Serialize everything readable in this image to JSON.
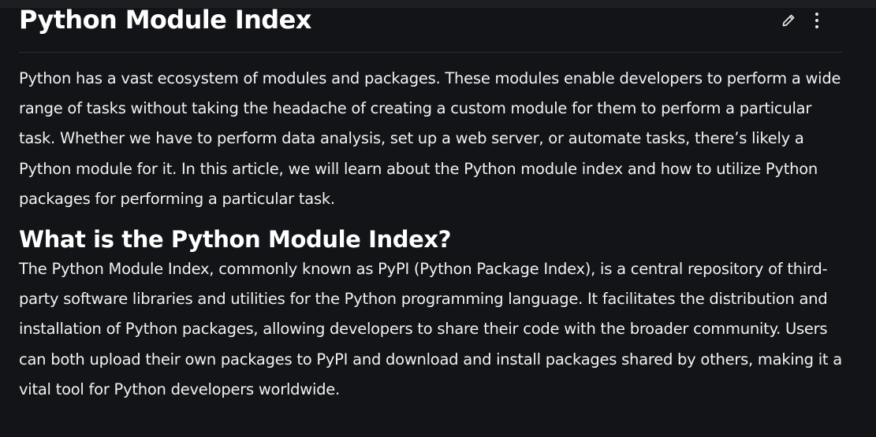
{
  "article": {
    "title": "Python Module Index",
    "intro": "Python has a vast ecosystem of modules and packages. These modules enable developers to perform a wide range of tasks without taking the headache of creating a custom module for them to perform a particular task. Whether we have to perform data analysis, set up a web server, or automate tasks, there’s likely a Python module for it. In this article, we will learn about the Python module index and how to utilize Python packages for performing a particular task.",
    "sections": [
      {
        "heading": "What is the Python Module Index?",
        "body": "The Python Module Index, commonly known as PyPI (Python Package Index), is a central repository of third-party software libraries and utilities for the Python programming language. It facilitates the distribution and installation of Python packages, allowing developers to share their code with the broader community. Users can both upload their own packages to PyPI and download and install packages shared by others, making it a vital tool for Python developers worldwide."
      }
    ]
  },
  "actions": {
    "edit_icon": "pencil-icon",
    "more_icon": "more-vertical-icon"
  },
  "colors": {
    "background": "#131417",
    "text": "#f2f2f2",
    "divider": "#2c2d31"
  }
}
